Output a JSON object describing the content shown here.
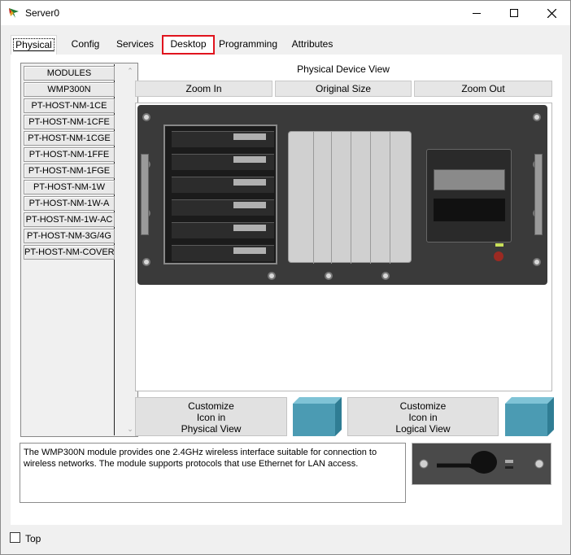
{
  "window": {
    "title": "Server0",
    "controls": {
      "minimize": "minimize-icon",
      "maximize": "maximize-icon",
      "close": "close-icon"
    }
  },
  "tabs": [
    {
      "label": "Physical",
      "active": true
    },
    {
      "label": "Config"
    },
    {
      "label": "Services"
    },
    {
      "label": "Desktop",
      "highlighted": true
    },
    {
      "label": "Programming"
    },
    {
      "label": "Attributes"
    }
  ],
  "modules": {
    "items": [
      "MODULES",
      "WMP300N",
      "PT-HOST-NM-1CE",
      "PT-HOST-NM-1CFE",
      "PT-HOST-NM-1CGE",
      "PT-HOST-NM-1FFE",
      "PT-HOST-NM-1FGE",
      "PT-HOST-NM-1W",
      "PT-HOST-NM-1W-A",
      "PT-HOST-NM-1W-AC",
      "PT-HOST-NM-3G/4G",
      "PT-HOST-NM-COVER"
    ]
  },
  "physical_view": {
    "title": "Physical Device View",
    "zoom_in": "Zoom In",
    "original_size": "Original Size",
    "zoom_out": "Zoom Out"
  },
  "customize": {
    "physical_line1": "Customize",
    "physical_line2": "Icon in",
    "physical_line3": "Physical View",
    "logical_line1": "Customize",
    "logical_line2": "Icon in",
    "logical_line3": "Logical View"
  },
  "description": "The WMP300N module provides one 2.4GHz wireless interface suitable for connection to wireless networks. The module supports protocols that use Ethernet for LAN access.",
  "bottom": {
    "top_label": "Top",
    "top_checked": false
  },
  "colors": {
    "highlight": "#e0141e",
    "cube": "#4b9bb3",
    "chassis": "#3a3a3a"
  }
}
